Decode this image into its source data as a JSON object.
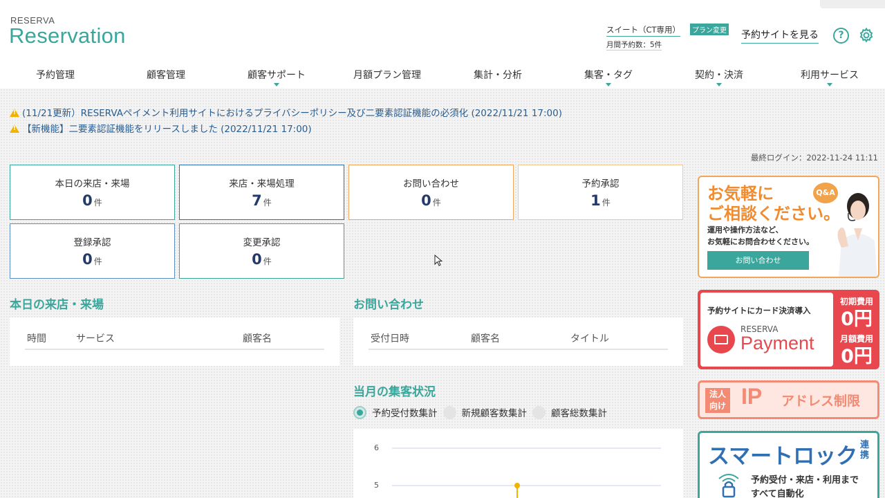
{
  "header": {
    "logo_small": "RESERVA",
    "logo_big": "Reservation",
    "plan_name": "スイート（CT専用）",
    "plan_change": "プラン変更",
    "monthly_count": "月間予約数：5件",
    "site_link": "予約サイトを見る",
    "help_symbol": "?",
    "help_icon": "help-circle-icon",
    "settings_icon": "gear-icon"
  },
  "nav": [
    {
      "label": "予約管理",
      "caret": false
    },
    {
      "label": "顧客管理",
      "caret": false
    },
    {
      "label": "顧客サポート",
      "caret": true
    },
    {
      "label": "月額プラン管理",
      "caret": false
    },
    {
      "label": "集計・分析",
      "caret": false
    },
    {
      "label": "集客・タグ",
      "caret": true
    },
    {
      "label": "契約・決済",
      "caret": true
    },
    {
      "label": "利用サービス",
      "caret": true
    }
  ],
  "notices": [
    "(11/21更新）RESERVAペイメント利用サイトにおけるプライバシーポリシー及び二要素認証機能の必須化 (2022/11/21 17:00)",
    "【新機能】二要素認証機能をリリースしました (2022/11/21 17:00)"
  ],
  "last_login": "最終ログイン：2022-11-24 11:11",
  "stats": [
    {
      "label": "本日の来店・来場",
      "value": "0",
      "unit": "件",
      "color": "#3aa69c"
    },
    {
      "label": "来店・来場処理",
      "value": "7",
      "unit": "件",
      "color": "#2f6fb3"
    },
    {
      "label": "お問い合わせ",
      "value": "0",
      "unit": "件",
      "color": "#f2a65a"
    },
    {
      "label": "予約承認",
      "value": "1",
      "unit": "件",
      "color": "#f5c992"
    },
    {
      "label": "登録承認",
      "value": "0",
      "unit": "件",
      "color": "#5b8fc7"
    },
    {
      "label": "変更承認",
      "value": "0",
      "unit": "件",
      "color": "#3aa69c"
    }
  ],
  "today_visits": {
    "title": "本日の来店・来場",
    "columns": [
      "時間",
      "サービス",
      "顧客名"
    ]
  },
  "inquiries": {
    "title": "お問い合わせ",
    "columns": [
      "受付日時",
      "顧客名",
      "タイトル"
    ]
  },
  "monthly": {
    "title": "当月の集客状況",
    "options": [
      {
        "label": "予約受付数集計",
        "selected": true
      },
      {
        "label": "新規顧客数集計",
        "selected": false
      },
      {
        "label": "顧客総数集計",
        "selected": false
      }
    ],
    "y_ticks": [
      "6",
      "5"
    ],
    "accent_color": "#f0b400"
  },
  "banners": {
    "consult": {
      "title_line1": "お気軽に",
      "title_line2": "ご相談ください。",
      "sub_line1": "運用や操作方法など、",
      "sub_line2": "お気軽にお問合わせください。",
      "badge": "Q&A",
      "button": "お問い合わせ"
    },
    "payment": {
      "headline": "予約サイトにカード決済導入",
      "brand_small": "RESERVA",
      "brand_big": "Payment",
      "initial_label": "初期費用",
      "initial_value": "0円",
      "monthly_label": "月額費用",
      "monthly_value": "0円"
    },
    "ip": {
      "corp_line1": "法人",
      "corp_line2": "向け",
      "ip": "IP",
      "text": "アドレス制限"
    },
    "smartlock": {
      "title": "スマートロック",
      "title_suffix": "連携",
      "line1": "予約受付・来店・利用まで",
      "line2": "すべて自動化"
    }
  }
}
